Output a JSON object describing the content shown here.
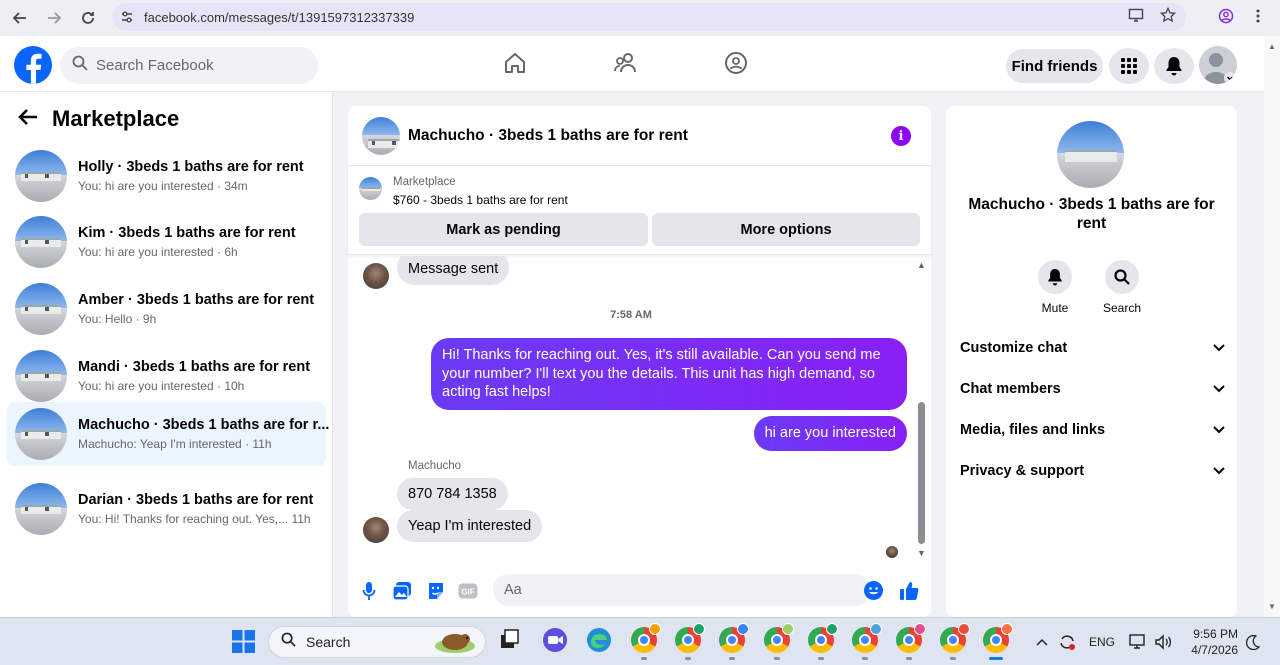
{
  "browser": {
    "url": "facebook.com/messages/t/1391597312337339"
  },
  "fb": {
    "search_placeholder": "Search Facebook",
    "find_friends": "Find friends"
  },
  "left": {
    "title": "Marketplace",
    "conversations": [
      {
        "name": "Holly · 3beds 1 baths are for rent",
        "preview": "You: hi are you interested · 34m",
        "active": false
      },
      {
        "name": "Kim · 3beds 1 baths are for rent",
        "preview": "You: hi are you interested · 6h",
        "active": false
      },
      {
        "name": "Amber · 3beds 1 baths are for rent",
        "preview": "You: Hello · 9h",
        "active": false
      },
      {
        "name": "Mandi · 3beds 1 baths are for rent",
        "preview": "You: hi are you interested · 10h",
        "active": false
      },
      {
        "name": "Machucho · 3beds 1 baths are for r...",
        "preview": "Machucho: Yeap I'm interested · 11h",
        "active": true
      },
      {
        "name": "Darian · 3beds 1 baths are for rent",
        "preview": "You: Hi! Thanks for reaching out. Yes,...  11h",
        "active": false
      }
    ]
  },
  "chat": {
    "title": "Machucho · 3beds 1 baths are for rent",
    "listing_label": "Marketplace",
    "listing_price": "$760 - 3beds 1 baths are for rent",
    "mark_pending": "Mark as pending",
    "more_options": "More options",
    "messages": {
      "sent_status": "Message sent",
      "timestamp": "7:58 AM",
      "outgoing_1": "Hi! Thanks for reaching out. Yes, it's still available. Can you send me your number? I'll text you the details. This unit has high demand, so acting fast helps!",
      "outgoing_2": "hi are you interested",
      "sender_name": "Machucho",
      "incoming_1": "870 784 1358",
      "incoming_2": "Yeap I'm interested"
    },
    "composer_placeholder": "Aa"
  },
  "right": {
    "title": "Machucho · 3beds 1 baths are for rent",
    "mute": "Mute",
    "search": "Search",
    "sections": [
      "Customize chat",
      "Chat members",
      "Media, files and links",
      "Privacy & support"
    ]
  },
  "taskbar": {
    "search": "Search",
    "lang": "ENG",
    "time": "9:56 PM",
    "date": "4/7/2026"
  },
  "colors": {
    "fb_blue": "#0866ff",
    "outgoing_bubble": "#7e2cf7",
    "info_purple": "#8a08f5"
  }
}
